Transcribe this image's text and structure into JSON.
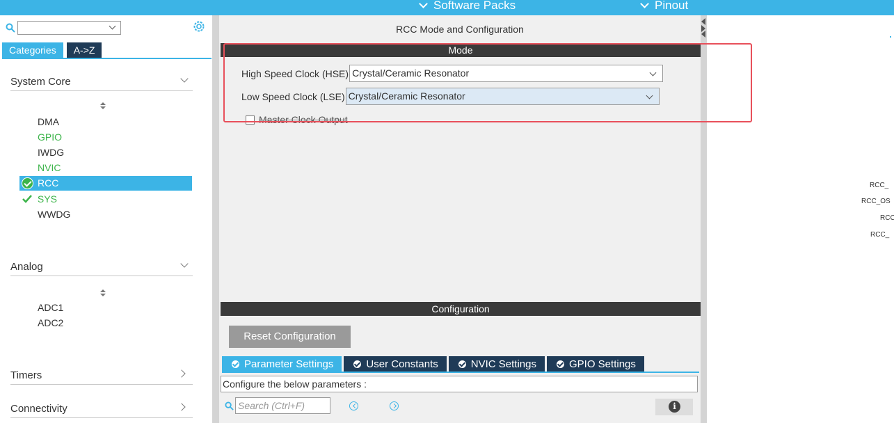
{
  "topbar": {
    "software_packs": "Software Packs",
    "pinout": "Pinout"
  },
  "left": {
    "tabs": {
      "categories": "Categories",
      "az": "A->Z"
    },
    "sections": {
      "system_core": "System Core",
      "analog": "Analog",
      "timers": "Timers",
      "connectivity": "Connectivity"
    },
    "system_core_items": {
      "dma": "DMA",
      "gpio": "GPIO",
      "iwdg": "IWDG",
      "nvic": "NVIC",
      "rcc": "RCC",
      "sys": "SYS",
      "wwdg": "WWDG"
    },
    "analog_items": {
      "adc1": "ADC1",
      "adc2": "ADC2"
    }
  },
  "center": {
    "title": "RCC Mode and Configuration",
    "mode_header": "Mode",
    "hse_label": "High Speed Clock (HSE)",
    "hse_value": "Crystal/Ceramic Resonator",
    "lse_label": "Low Speed Clock (LSE)",
    "lse_value": "Crystal/Ceramic Resonator",
    "master_clock_output": "Master Clock Output",
    "configuration_header": "Configuration",
    "reset_button": "Reset Configuration",
    "config_tabs": {
      "parameter": "Parameter Settings",
      "user_constants": "User Constants",
      "nvic": "NVIC Settings",
      "gpio": "GPIO Settings"
    },
    "configure_text": "Configure the below parameters :",
    "search_placeholder": "Search (Ctrl+F)"
  },
  "right": {
    "pins": {
      "p1": "RCC_",
      "p2": "RCC_OS",
      "p3": "RCC",
      "p4": "RCC_"
    }
  },
  "colors": {
    "accent": "#3cb4e6",
    "dark_tab": "#1f3b57",
    "ok_green": "#3cb44a",
    "highlight": "#e8505b"
  }
}
